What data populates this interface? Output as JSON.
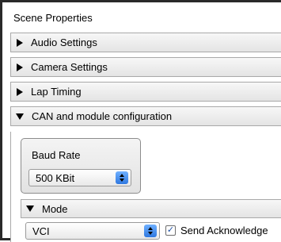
{
  "panel": {
    "title": "Scene Properties"
  },
  "sections": {
    "audio": {
      "label": "Audio Settings",
      "expanded": false
    },
    "camera": {
      "label": "Camera Settings",
      "expanded": false
    },
    "lap": {
      "label": "Lap Timing",
      "expanded": false
    },
    "can": {
      "label": "CAN and module configuration",
      "expanded": true
    }
  },
  "baud": {
    "title": "Baud Rate",
    "value": "500 KBit"
  },
  "mode": {
    "header": "Mode",
    "value": "VCI",
    "send_ack_label": "Send Acknowledge",
    "send_ack_checked": true
  },
  "icons": {
    "collapsed": "triangle-right-icon",
    "expanded": "triangle-down-icon",
    "select_arrows": "updown-arrow-icon",
    "check": "checkmark-icon"
  }
}
